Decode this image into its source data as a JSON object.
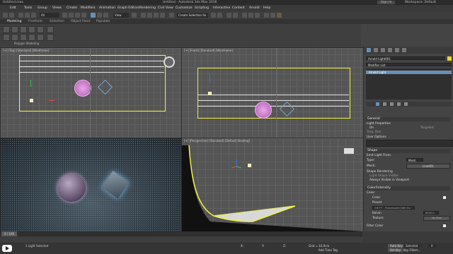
{
  "titlebar": {
    "left": "Untitled.max",
    "center": "Untitled - Autodesk 3ds Max 2016",
    "right_signin": "Sign In",
    "workspace": "Workspace: Default"
  },
  "menu": [
    "Edit",
    "Tools",
    "Group",
    "Views",
    "Create",
    "Modifiers",
    "Animation",
    "Graph Editors",
    "Rendering",
    "Civil View",
    "Customize",
    "Scripting",
    "Interactive",
    "Content",
    "Arnold",
    "Help"
  ],
  "toolbar": {
    "selection_filter": "All",
    "view_dropdown": "View",
    "create_selection_set": "Create Selection Se"
  },
  "ribbon": {
    "tabs": [
      "Modeling",
      "Freeform",
      "Selection",
      "Object Paint",
      "Populate"
    ],
    "group_label": "Polygon Modeling"
  },
  "viewports": {
    "top_left": "[+] [Top] [Standard] [Wireframe]",
    "top_right": "[+] [Front] [Standard] [Wireframe]",
    "bottom_left": "",
    "bottom_right": "[+] [Perspective] [Standard] [Default Shading]"
  },
  "command_panel": {
    "object_name": "Arnold Light001",
    "modifier_list": "Modifier List",
    "stack_item": "Arnold Light",
    "rollout_general": "General",
    "light_properties": "Light Properties",
    "on_label": "On",
    "targeted_label": "Targeted",
    "targ_dist": "Targ. Dist.",
    "user_options": "User Options",
    "rollout_shape": "Shape",
    "emit_light_from": "Emit Light From",
    "type_label": "Type:",
    "type_value": "Mesh",
    "mesh_label": "Mesh:",
    "mesh_value": "Line001",
    "shape_rendering": "Shape Rendering",
    "light_shape_visible": "Light Shape Visible",
    "always_visible": "Always Visible in Viewport",
    "rollout_color": "Color/Intensity",
    "color_label": "Color",
    "color_radio": "Color",
    "preset_radio": "Preset",
    "preset_value": "CIE F7 - Fluorescent D65 Illu",
    "kelvin_radio": "Kelvin",
    "kelvin_value": "6500.0",
    "texture_radio": "Texture",
    "texture_value": "No Map",
    "filter_color": "Filter Color",
    "light_color": "#f2d22a"
  },
  "timeline": {
    "frame_display": "0 / 100"
  },
  "status": {
    "message": "1 Light Selected",
    "x_label": "X:",
    "y_label": "Y:",
    "z_label": "Z:",
    "grid": "Grid = 10.0cm",
    "add_time_tag": "Add Time Tag",
    "auto_key": "Auto Key",
    "set_key": "Set Key",
    "selected": "Selected",
    "key_filters": "Key Filters...",
    "frame": "0"
  }
}
